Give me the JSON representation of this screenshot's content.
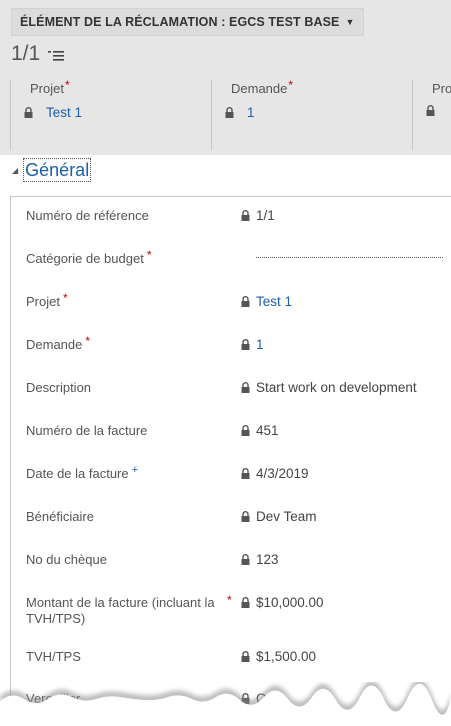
{
  "header": {
    "entity_title": "ÉLÉMENT DE LA RÉCLAMATION : EGCS TEST BASE",
    "pager_count": "1/1"
  },
  "summary": [
    {
      "label": "Projet",
      "required": "*",
      "value": "Test 1"
    },
    {
      "label": "Demande",
      "required": "*",
      "value": "1"
    },
    {
      "label": "Pro",
      "required": "",
      "value": ""
    }
  ],
  "section": {
    "title": "Général"
  },
  "fields": [
    {
      "label": "Numéro de référence",
      "required": "",
      "value": "1/1",
      "locked": true,
      "link": false
    },
    {
      "label": "Catégorie de budget",
      "required": "*",
      "value": "",
      "locked": false,
      "link": false
    },
    {
      "label": "Projet",
      "required": "*",
      "value": "Test 1",
      "locked": true,
      "link": true
    },
    {
      "label": "Demande",
      "required": "*",
      "value": "1",
      "locked": true,
      "link": true
    },
    {
      "label": "Description",
      "required": "",
      "value": "Start work on development",
      "locked": true,
      "link": false
    },
    {
      "label": "Numéro de la facture",
      "required": "",
      "value": "451",
      "locked": true,
      "link": false
    },
    {
      "label": "Date de la facture",
      "recommended": "+",
      "value": "4/3/2019",
      "locked": true,
      "link": false
    },
    {
      "label": "Bénéficiaire",
      "required": "",
      "value": "Dev Team",
      "locked": true,
      "link": false
    },
    {
      "label": "No du chèque",
      "required": "",
      "value": "123",
      "locked": true,
      "link": false
    },
    {
      "label": "Montant de la facture (incluant la TVH/TPS)",
      "required": "*",
      "value": "$10,000.00",
      "locked": true,
      "link": false
    },
    {
      "label": "TVH/TPS",
      "required": "",
      "value": "$1,500.00",
      "locked": true,
      "link": false
    },
    {
      "label": "Verouiller",
      "required": "",
      "value": "Oui",
      "locked": true,
      "link": false
    }
  ],
  "colors": {
    "header_bg": "#e6e6e6",
    "link": "#1c5fa8",
    "required": "#c00000",
    "text": "#444444"
  },
  "icons": {
    "lock": "lock-icon",
    "list": "list-icon",
    "caret": "caret-down-icon",
    "collapse": "collapse-triangle-icon"
  }
}
